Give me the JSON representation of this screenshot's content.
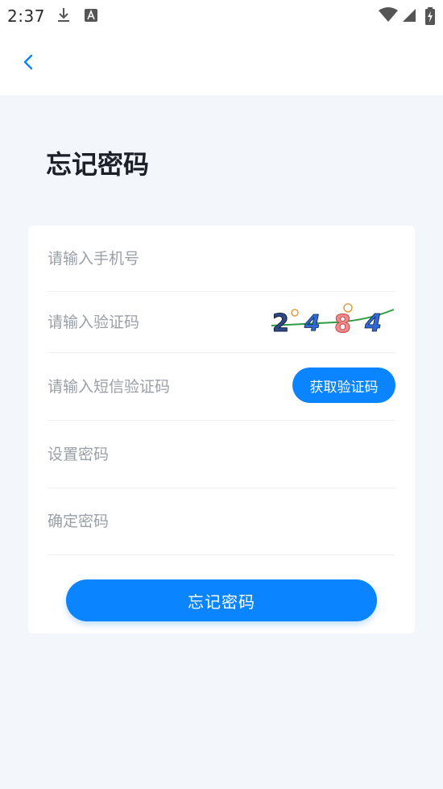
{
  "status_bar": {
    "time": "2:37",
    "icons": [
      "download-icon",
      "text-a-icon",
      "wifi-icon",
      "signal-icon",
      "battery-icon"
    ]
  },
  "header": {
    "back_icon": "chevron-left-icon"
  },
  "page": {
    "title": "忘记密码"
  },
  "form": {
    "phone_placeholder": "请输入手机号",
    "captcha_placeholder": "请输入验证码",
    "captcha_text": "24884",
    "sms_placeholder": "请输入短信验证码",
    "sms_button_label": "获取验证码",
    "password_placeholder": "设置密码",
    "confirm_password_placeholder": "确定密码",
    "submit_label": "忘记密码"
  },
  "colors": {
    "accent": "#0a84ff",
    "background": "#f3f6fa"
  }
}
